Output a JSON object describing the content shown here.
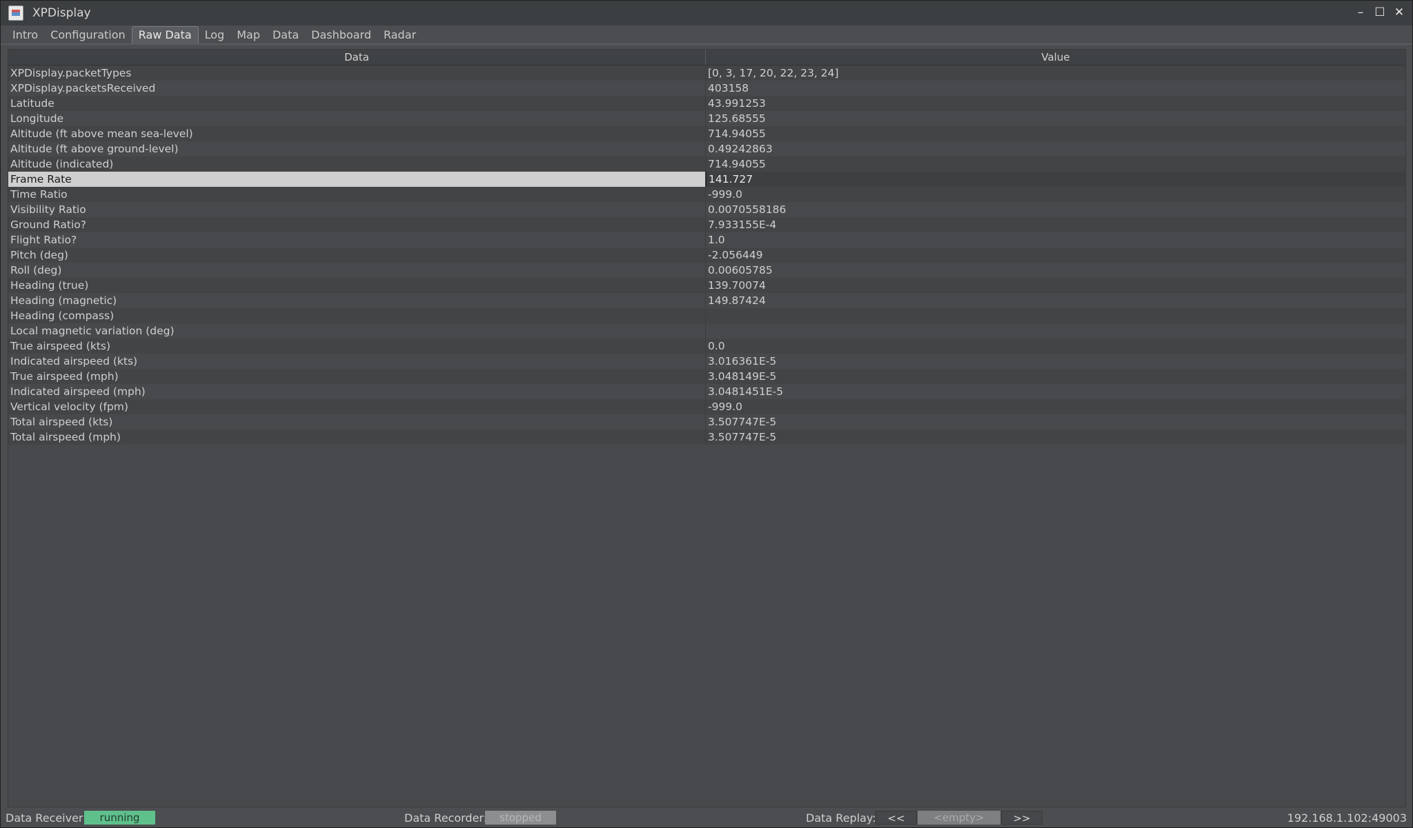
{
  "window": {
    "title": "XPDisplay"
  },
  "window_controls": {
    "minimize": "–",
    "maximize": "☐",
    "close": "✕"
  },
  "tabs": [
    {
      "label": "Intro",
      "active": false
    },
    {
      "label": "Configuration",
      "active": false
    },
    {
      "label": "Raw Data",
      "active": true
    },
    {
      "label": "Log",
      "active": false
    },
    {
      "label": "Map",
      "active": false
    },
    {
      "label": "Data",
      "active": false
    },
    {
      "label": "Dashboard",
      "active": false
    },
    {
      "label": "Radar",
      "active": false
    }
  ],
  "table": {
    "headers": {
      "data": "Data",
      "value": "Value"
    },
    "selected_row": 7,
    "rows": [
      {
        "data": "XPDisplay.packetTypes",
        "value": "[0, 3, 17, 20, 22, 23, 24]"
      },
      {
        "data": "XPDisplay.packetsReceived",
        "value": "403158"
      },
      {
        "data": "Latitude",
        "value": "43.991253"
      },
      {
        "data": "Longitude",
        "value": "125.68555"
      },
      {
        "data": "Altitude (ft above mean sea-level)",
        "value": "714.94055"
      },
      {
        "data": "Altitude (ft above ground-level)",
        "value": "0.49242863"
      },
      {
        "data": "Altitude (indicated)",
        "value": "714.94055"
      },
      {
        "data": "Frame Rate",
        "value": "141.727"
      },
      {
        "data": "Time Ratio",
        "value": "-999.0"
      },
      {
        "data": "Visibility Ratio",
        "value": "0.0070558186"
      },
      {
        "data": "Ground Ratio?",
        "value": "7.933155E-4"
      },
      {
        "data": "Flight Ratio?",
        "value": "1.0"
      },
      {
        "data": "Pitch (deg)",
        "value": "-2.056449"
      },
      {
        "data": "Roll (deg)",
        "value": "0.00605785"
      },
      {
        "data": "Heading (true)",
        "value": "139.70074"
      },
      {
        "data": "Heading (magnetic)",
        "value": "149.87424"
      },
      {
        "data": "Heading (compass)",
        "value": ""
      },
      {
        "data": "Local magnetic variation (deg)",
        "value": ""
      },
      {
        "data": "True airspeed (kts)",
        "value": "0.0"
      },
      {
        "data": "Indicated airspeed (kts)",
        "value": "3.016361E-5"
      },
      {
        "data": "True airspeed (mph)",
        "value": "3.048149E-5"
      },
      {
        "data": "Indicated airspeed (mph)",
        "value": "3.0481451E-5"
      },
      {
        "data": "Vertical velocity (fpm)",
        "value": "-999.0"
      },
      {
        "data": "Total airspeed (kts)",
        "value": "3.507747E-5"
      },
      {
        "data": "Total airspeed (mph)",
        "value": "3.507747E-5"
      }
    ]
  },
  "statusbar": {
    "receiver_label": "Data Receiver:",
    "receiver_status": "running",
    "recorder_label": "Data Recorder:",
    "recorder_status": "stopped",
    "replay_label": "Data Replay:",
    "replay_prev": "<<",
    "replay_file": "<empty>",
    "replay_next": ">>",
    "address": "192.168.1.102:49003"
  },
  "colors": {
    "running": "#5fc08c",
    "stopped": "#8c8e90",
    "selected_row": "#cfcfcf"
  }
}
